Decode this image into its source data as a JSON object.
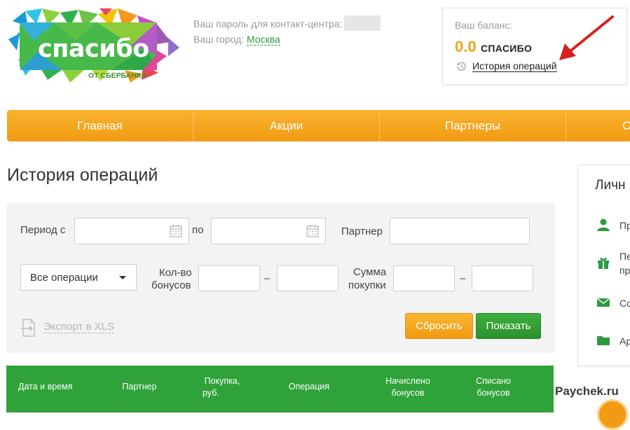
{
  "logo": {
    "brand": "спасибо",
    "subtitle": "ОТ СБЕРБАНКА"
  },
  "header": {
    "password_label": "Ваш пароль для контакт-центра:",
    "city_label": "Ваш город:",
    "city_value": "Москва"
  },
  "balance": {
    "label": "Ваш баланс:",
    "value": "0.0",
    "unit": "СПАСИБО",
    "history_link": "История операций"
  },
  "nav": {
    "items": [
      {
        "label": "Главная"
      },
      {
        "label": "Акции"
      },
      {
        "label": "Партнеры"
      },
      {
        "label": "С"
      }
    ]
  },
  "page": {
    "title": "История операций"
  },
  "filters": {
    "period_from_label": "Период с",
    "period_to_label": "по",
    "partner_label": "Партнер",
    "operations_select": "Все операции",
    "bonus_count_label_1": "Кол-во",
    "bonus_count_label_2": "бонусов",
    "purchase_sum_label_1": "Сумма",
    "purchase_sum_label_2": "покупки",
    "range_dash": "–",
    "export_label": "Экспорт в XLS",
    "reset_button": "Сбросить",
    "show_button": "Показать"
  },
  "table": {
    "headers": [
      {
        "line1": "Дата и время",
        "line2": ""
      },
      {
        "line1": "Партнер",
        "line2": ""
      },
      {
        "line1": "Покупка,",
        "line2": "руб."
      },
      {
        "line1": "Операция",
        "line2": ""
      },
      {
        "line1": "Начислено",
        "line2": "бонусов"
      },
      {
        "line1": "Списано",
        "line2": "бонусов"
      }
    ]
  },
  "sidebar": {
    "title": "Личн",
    "items": [
      {
        "line1": "Пр",
        "line2": ""
      },
      {
        "line1": "Пе",
        "line2": "пр"
      },
      {
        "line1": "Со",
        "line2": ""
      },
      {
        "line1": "Ар",
        "line2": ""
      }
    ]
  },
  "watermark": "Paychek.ru",
  "colors": {
    "orange": "#f29a14",
    "green": "#2fa23a",
    "link_green": "#2e9a3f",
    "balance_orange": "#f0a31a"
  },
  "icons": [
    "history-icon",
    "calendar-icon",
    "export-icon",
    "user-icon",
    "gift-icon",
    "mail-icon",
    "folder-icon",
    "red-arrow"
  ]
}
